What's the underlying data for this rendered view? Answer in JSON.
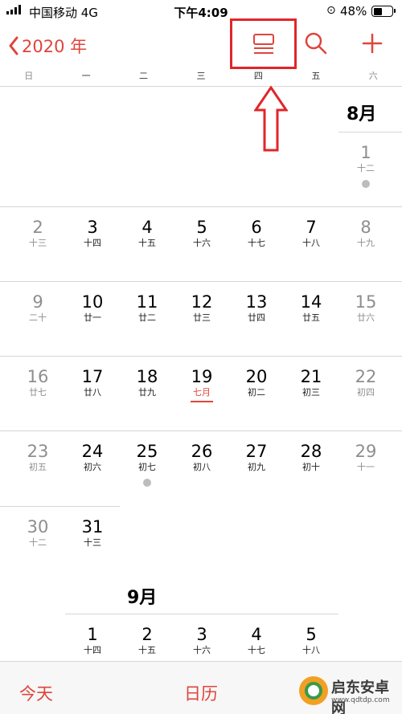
{
  "status_bar": {
    "carrier": "中国移动 4G",
    "time": "下午4:09",
    "battery_pct": "48%",
    "battery_level": 0.48
  },
  "nav": {
    "back_label": "2020 年",
    "icons": [
      "list-view-icon",
      "search-icon",
      "add-icon"
    ],
    "accent_color": "#e0443c",
    "highlight_color": "#e0262a"
  },
  "weekdays": [
    "日",
    "一",
    "二",
    "三",
    "四",
    "五",
    "六"
  ],
  "months": [
    {
      "label": "8月",
      "weeks": [
        [
          null,
          null,
          null,
          null,
          null,
          null,
          {
            "n": "1",
            "l": "十二",
            "dot": true
          }
        ],
        [
          {
            "n": "2",
            "l": "十三"
          },
          {
            "n": "3",
            "l": "十四"
          },
          {
            "n": "4",
            "l": "十五"
          },
          {
            "n": "5",
            "l": "十六"
          },
          {
            "n": "6",
            "l": "十七"
          },
          {
            "n": "7",
            "l": "十八"
          },
          {
            "n": "8",
            "l": "十九"
          }
        ],
        [
          {
            "n": "9",
            "l": "二十"
          },
          {
            "n": "10",
            "l": "廿一"
          },
          {
            "n": "11",
            "l": "廿二"
          },
          {
            "n": "12",
            "l": "廿三"
          },
          {
            "n": "13",
            "l": "廿四"
          },
          {
            "n": "14",
            "l": "廿五"
          },
          {
            "n": "15",
            "l": "廿六"
          }
        ],
        [
          {
            "n": "16",
            "l": "廿七"
          },
          {
            "n": "17",
            "l": "廿八"
          },
          {
            "n": "18",
            "l": "廿九"
          },
          {
            "n": "19",
            "l": "七月",
            "today": true
          },
          {
            "n": "20",
            "l": "初二"
          },
          {
            "n": "21",
            "l": "初三"
          },
          {
            "n": "22",
            "l": "初四"
          }
        ],
        [
          {
            "n": "23",
            "l": "初五"
          },
          {
            "n": "24",
            "l": "初六"
          },
          {
            "n": "25",
            "l": "初七",
            "dot": true
          },
          {
            "n": "26",
            "l": "初八"
          },
          {
            "n": "27",
            "l": "初九"
          },
          {
            "n": "28",
            "l": "初十"
          },
          {
            "n": "29",
            "l": "十一"
          }
        ],
        [
          {
            "n": "30",
            "l": "十二"
          },
          {
            "n": "31",
            "l": "十三"
          },
          null,
          null,
          null,
          null,
          null
        ]
      ]
    },
    {
      "label": "9月",
      "weeks": [
        [
          null,
          {
            "n": "1",
            "l": "十四"
          },
          {
            "n": "2",
            "l": "十五"
          },
          {
            "n": "3",
            "l": "十六"
          },
          {
            "n": "4",
            "l": "十七"
          },
          {
            "n": "5",
            "l": "十八"
          }
        ]
      ]
    }
  ],
  "tabbar": {
    "today_label": "今天",
    "calendars_label": "日历"
  },
  "watermark": {
    "title": "启东安卓网",
    "url": "www.qdtdp.com"
  }
}
